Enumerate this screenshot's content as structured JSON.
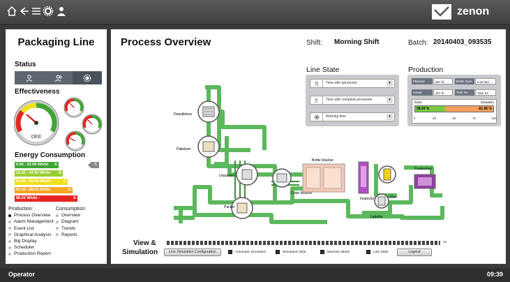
{
  "toolbar": {
    "icons": [
      "home-icon",
      "back-icon",
      "list-icon",
      "gear-icon",
      "user-icon"
    ],
    "logo_text": "zenon"
  },
  "left_panel": {
    "title": "Packaging Line",
    "status_label": "Status",
    "status_icons": [
      "user-icon",
      "users-icon",
      "gear-icon"
    ],
    "effectiveness_label": "Effectiveness",
    "oee_label": "OEE",
    "energy_label": "Energy Consumption",
    "energy_bars": [
      {
        "range": "0.00 - 22.00 Wh/bt",
        "class": "A",
        "color": "#3fa535",
        "width": 0.56
      },
      {
        "range": "22.00 - 44.00 Wh/bt",
        "class": "B",
        "color": "#9acd32",
        "width": 0.62
      },
      {
        "range": "44.00 - 66.00 Wh/bt",
        "class": "C",
        "color": "#f0e020",
        "width": 0.68
      },
      {
        "range": "66.00 - 88.00 Wh/bt",
        "class": "D",
        "color": "#f5a623",
        "width": 0.74
      },
      {
        "range": "88.00 Wh/bt -",
        "class": "E",
        "color": "#e52620",
        "width": 0.8
      }
    ],
    "energy_marker": "A",
    "production_header": "Production:",
    "production_items": [
      {
        "label": "Process Overview",
        "active": true
      },
      {
        "label": "Alarm Management",
        "active": false
      },
      {
        "label": "Event List",
        "active": false
      },
      {
        "label": "Graphical Analysis",
        "active": false
      },
      {
        "label": "Big Display",
        "active": false
      },
      {
        "label": "Scheduler",
        "active": false
      },
      {
        "label": "Production Report",
        "active": false
      }
    ],
    "consumption_header": "Consumption:",
    "consumption_items": [
      {
        "label": "Overview"
      },
      {
        "label": "Diagram"
      },
      {
        "label": "Trends"
      },
      {
        "label": "Reports"
      }
    ]
  },
  "main": {
    "title": "Process Overview",
    "shift_label": "Shift:",
    "shift_value": "Morning Shift",
    "batch_label": "Batch:",
    "batch_value": "20140403_093535",
    "line_state": {
      "title": "Line State",
      "dropdowns": [
        {
          "icon": "user-icon",
          "value": "Time with personnel"
        },
        {
          "icon": "users-icon",
          "value": "Time with complete personnel"
        },
        {
          "icon": "gear-icon",
          "value": "Working time"
        }
      ]
    },
    "production": {
      "title": "Production",
      "rows": [
        [
          {
            "label": "Planned",
            "value": "897 lit"
          },
          {
            "label": "Bottle Type",
            "value": "0.33 liter"
          }
        ],
        [
          {
            "label": "Actual",
            "value": "307 lit"
          },
          {
            "label": "Tank No.",
            "value": "Tank 03"
          }
        ]
      ],
      "done_label": "Done",
      "deviation_label": "Deviation",
      "done_value": "38.04 %",
      "deviation_value": "-61.96 %",
      "done_fraction": 0.3804,
      "scale": [
        "0",
        "25",
        "50",
        "75",
        "100"
      ]
    },
    "machines": {
      "depalletizer": "Depalletizer",
      "palletizer": "Palletizer",
      "unpacker": "Unpacker",
      "packer": "Packer",
      "bottle_washer": "Bottle Washer",
      "crate_washer": "Crate Washer",
      "inspector": "Inspector",
      "filler": "Filler",
      "labeller": "Labeller",
      "pasteuriser": "Pasteuriser"
    },
    "view_sim": {
      "title_line1": "View &",
      "title_line2": "Simulation",
      "config_button": "Line Simulation Configuration",
      "checkboxes": [
        "Automatic simulation",
        "Simulation slide",
        "Machine labels",
        "Line State"
      ],
      "legend_button": "Legend",
      "slider_max": "25"
    }
  },
  "footer": {
    "user": "Operator",
    "time": "09:39"
  },
  "colors": {
    "conveyor": "#5cb85c",
    "conveyor_dark": "#3f8f3f",
    "panel_gray": "#5e6670"
  }
}
